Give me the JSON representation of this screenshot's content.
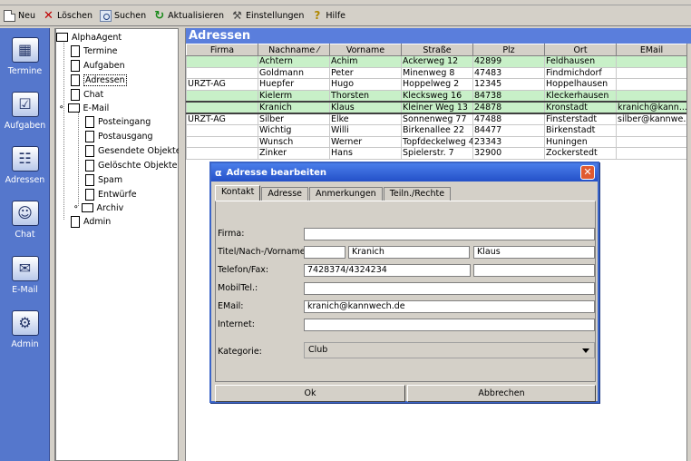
{
  "toolbar": {
    "new_label": "Neu",
    "delete_label": "Löschen",
    "search_label": "Suchen",
    "refresh_label": "Aktualisieren",
    "settings_label": "Einstellungen",
    "help_label": "Hilfe"
  },
  "leftbar": {
    "items": [
      {
        "label": "Termine"
      },
      {
        "label": "Aufgaben"
      },
      {
        "label": "Adressen"
      },
      {
        "label": "Chat"
      },
      {
        "label": "E-Mail"
      },
      {
        "label": "Admin"
      }
    ]
  },
  "tree": {
    "root": "AlphaAgent",
    "items": [
      "Termine",
      "Aufgaben",
      "Adressen",
      "Chat",
      "E-Mail"
    ],
    "email_children": [
      "Posteingang",
      "Postausgang",
      "Gesendete Objekte",
      "Gelöschte Objekte",
      "Spam",
      "Entwürfe",
      "Archiv"
    ],
    "admin": "Admin"
  },
  "main": {
    "title": "Adressen",
    "columns": [
      "Firma",
      "Nachname ⁄",
      "Vorname",
      "Straße",
      "Plz",
      "Ort",
      "EMail"
    ],
    "rows": [
      [
        "",
        "Achtern",
        "Achim",
        "Ackerweg 12",
        "42899",
        "Feldhausen",
        ""
      ],
      [
        "",
        "Goldmann",
        "Peter",
        "Minenweg 8",
        "47483",
        "Findmichdorf",
        ""
      ],
      [
        "URZT-AG",
        "Huepfer",
        "Hugo",
        "Hoppelweg 2",
        "12345",
        "Hoppelhausen",
        ""
      ],
      [
        "",
        "Kielerm",
        "Thorsten",
        "Klecksweg 16",
        "84738",
        "Kleckerhausen",
        ""
      ],
      [
        "",
        "Kranich",
        "Klaus",
        "Kleiner Weg 13",
        "24878",
        "Kronstadt",
        "kranich@kann..."
      ],
      [
        "URZT-AG",
        "Silber",
        "Elke",
        "Sonnenweg 77",
        "47488",
        "Finsterstadt",
        "silber@kannwe..."
      ],
      [
        "",
        "Wichtig",
        "Willi",
        "Birkenallee 22",
        "84477",
        "Birkenstadt",
        ""
      ],
      [
        "",
        "Wunsch",
        "Werner",
        "Topfdeckelweg 4",
        "23343",
        "Huningen",
        ""
      ],
      [
        "",
        "Zinker",
        "Hans",
        "Spielerstr. 7",
        "32900",
        "Zockerstedt",
        ""
      ]
    ]
  },
  "dialog": {
    "title": "Adresse bearbeiten",
    "logo": "α",
    "tabs": [
      "Kontakt",
      "Adresse",
      "Anmerkungen",
      "Teiln./Rechte"
    ],
    "labels": {
      "firma": "Firma:",
      "titel": "Titel/Nach-/Vorname:",
      "telefon": "Telefon/Fax:",
      "mobil": "MobilTel.:",
      "email": "EMail:",
      "internet": "Internet:",
      "kategorie": "Kategorie:"
    },
    "values": {
      "firma": "",
      "titel": "",
      "nachname": "Kranich",
      "vorname": "Klaus",
      "telefon": "7428374/4324234",
      "fax": "",
      "mobil": "",
      "email": "kranich@kannwech.de",
      "internet": "",
      "kategorie": "Club"
    },
    "ok_label": "Ok",
    "cancel_label": "Abbrechen"
  }
}
